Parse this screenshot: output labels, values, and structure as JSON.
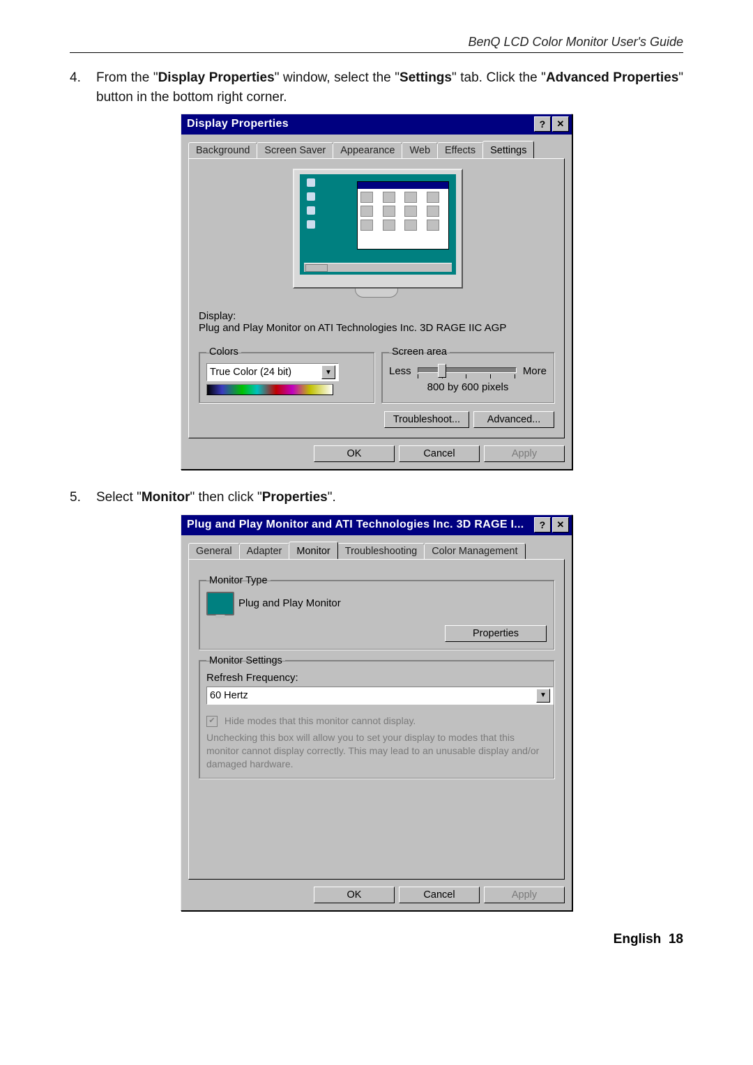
{
  "header": {
    "doc_title": "BenQ LCD Color Monitor User's Guide"
  },
  "steps": {
    "s4": {
      "num": "4.",
      "pre": "From the \"",
      "b1": "Display Properties",
      "mid1": "\" window, select the \"",
      "b2": "Settings",
      "mid2": "\" tab. Click the \"",
      "b3": "Advanced Properties",
      "post": "\" button in the bottom right corner."
    },
    "s5": {
      "num": "5.",
      "pre": "Select \"",
      "b1": "Monitor",
      "mid": "\" then click \"",
      "b2": "Properties",
      "post": "\"."
    }
  },
  "dialog1": {
    "title": "Display Properties",
    "tabs": {
      "background": "Background",
      "screensaver": "Screen Saver",
      "appearance": "Appearance",
      "web": "Web",
      "effects": "Effects",
      "settings": "Settings"
    },
    "display_label": "Display:",
    "display_value": "Plug and Play Monitor on ATI Technologies Inc. 3D RAGE IIC AGP",
    "colors_legend": "Colors",
    "colors_value": "True Color (24 bit)",
    "screenarea_legend": "Screen area",
    "less": "Less",
    "more": "More",
    "resolution": "800 by 600 pixels",
    "troubleshoot": "Troubleshoot...",
    "advanced": "Advanced...",
    "ok": "OK",
    "cancel": "Cancel",
    "apply": "Apply"
  },
  "dialog2": {
    "title": "Plug and Play Monitor and ATI Technologies Inc. 3D RAGE I...",
    "tabs": {
      "general": "General",
      "adapter": "Adapter",
      "monitor": "Monitor",
      "troubleshooting": "Troubleshooting",
      "colormgmt": "Color Management"
    },
    "monitor_type_legend": "Monitor Type",
    "monitor_name": "Plug and Play Monitor",
    "properties_btn": "Properties",
    "monitor_settings_legend": "Monitor Settings",
    "refresh_label": "Refresh Frequency:",
    "refresh_value": "60 Hertz",
    "hide_modes": "Hide modes that this monitor cannot display.",
    "hide_hint": "Unchecking this box will allow you to set your display to modes that this monitor cannot display correctly. This may lead to an unusable display and/or damaged hardware.",
    "ok": "OK",
    "cancel": "Cancel",
    "apply": "Apply"
  },
  "footer": {
    "lang": "English",
    "page": "18"
  }
}
